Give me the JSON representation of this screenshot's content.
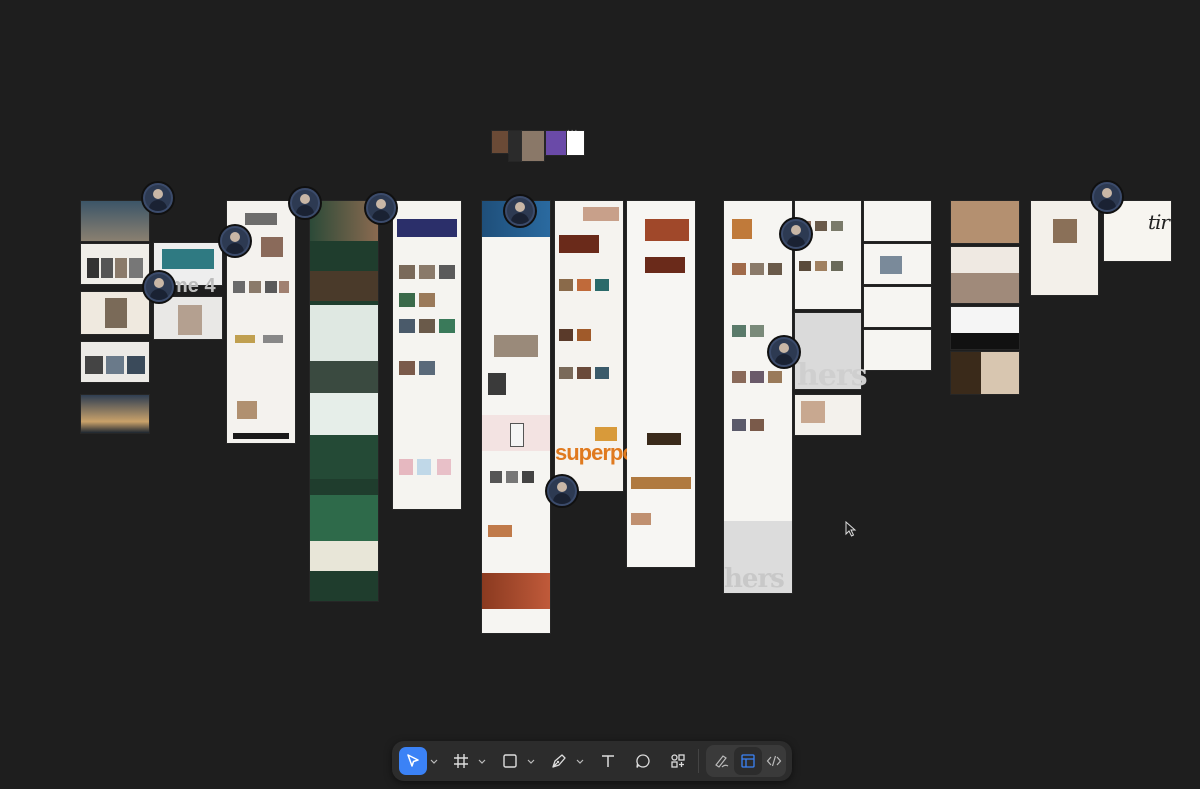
{
  "canvas": {
    "frame_label_home4": "me 4",
    "hers_text": "hers",
    "superpower_text": "superpower",
    "tin_text": "tir",
    "top_dots": "..."
  },
  "toolbar": {
    "tools": [
      {
        "name": "move-tool",
        "icon": "cursor-arrow-icon",
        "active": true
      },
      {
        "name": "frame-tool",
        "icon": "hash-frame-icon",
        "active": false
      },
      {
        "name": "shape-tool",
        "icon": "rectangle-icon",
        "active": false
      },
      {
        "name": "pen-tool",
        "icon": "pen-icon",
        "active": false
      },
      {
        "name": "text-tool",
        "icon": "text-icon",
        "active": false
      },
      {
        "name": "comment-tool",
        "icon": "comment-bubble-icon",
        "active": false
      },
      {
        "name": "actions-tool",
        "icon": "components-icon",
        "active": false
      }
    ],
    "mode_buttons": [
      {
        "name": "draw-mode",
        "icon": "pencil-scribble-icon"
      },
      {
        "name": "design-mode",
        "icon": "design-layout-icon",
        "active": true
      },
      {
        "name": "dev-mode",
        "icon": "code-brackets-icon"
      }
    ]
  },
  "colors": {
    "background": "#1e1e1e",
    "toolbar": "#2c2c2c",
    "accent": "#3b82f6"
  }
}
